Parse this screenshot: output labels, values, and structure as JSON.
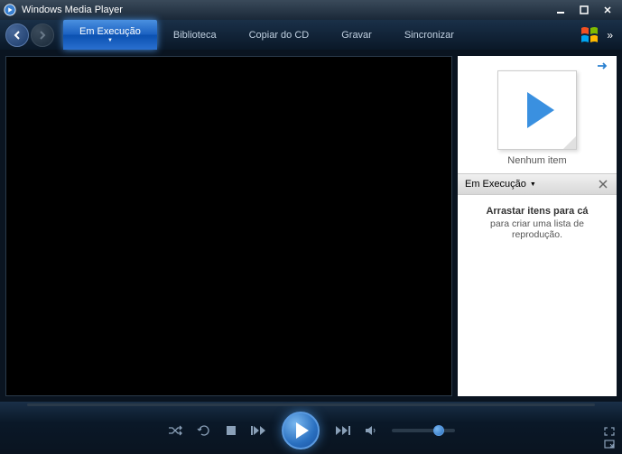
{
  "title": "Windows Media Player",
  "tabs": {
    "now_playing": "Em Execução",
    "library": "Biblioteca",
    "rip": "Copiar do CD",
    "burn": "Gravar",
    "sync": "Sincronizar"
  },
  "side": {
    "no_item": "Nenhum item",
    "dropdown_label": "Em Execução",
    "drag_title": "Arrastar itens para cá",
    "drag_sub": "para criar uma lista de reprodução."
  }
}
